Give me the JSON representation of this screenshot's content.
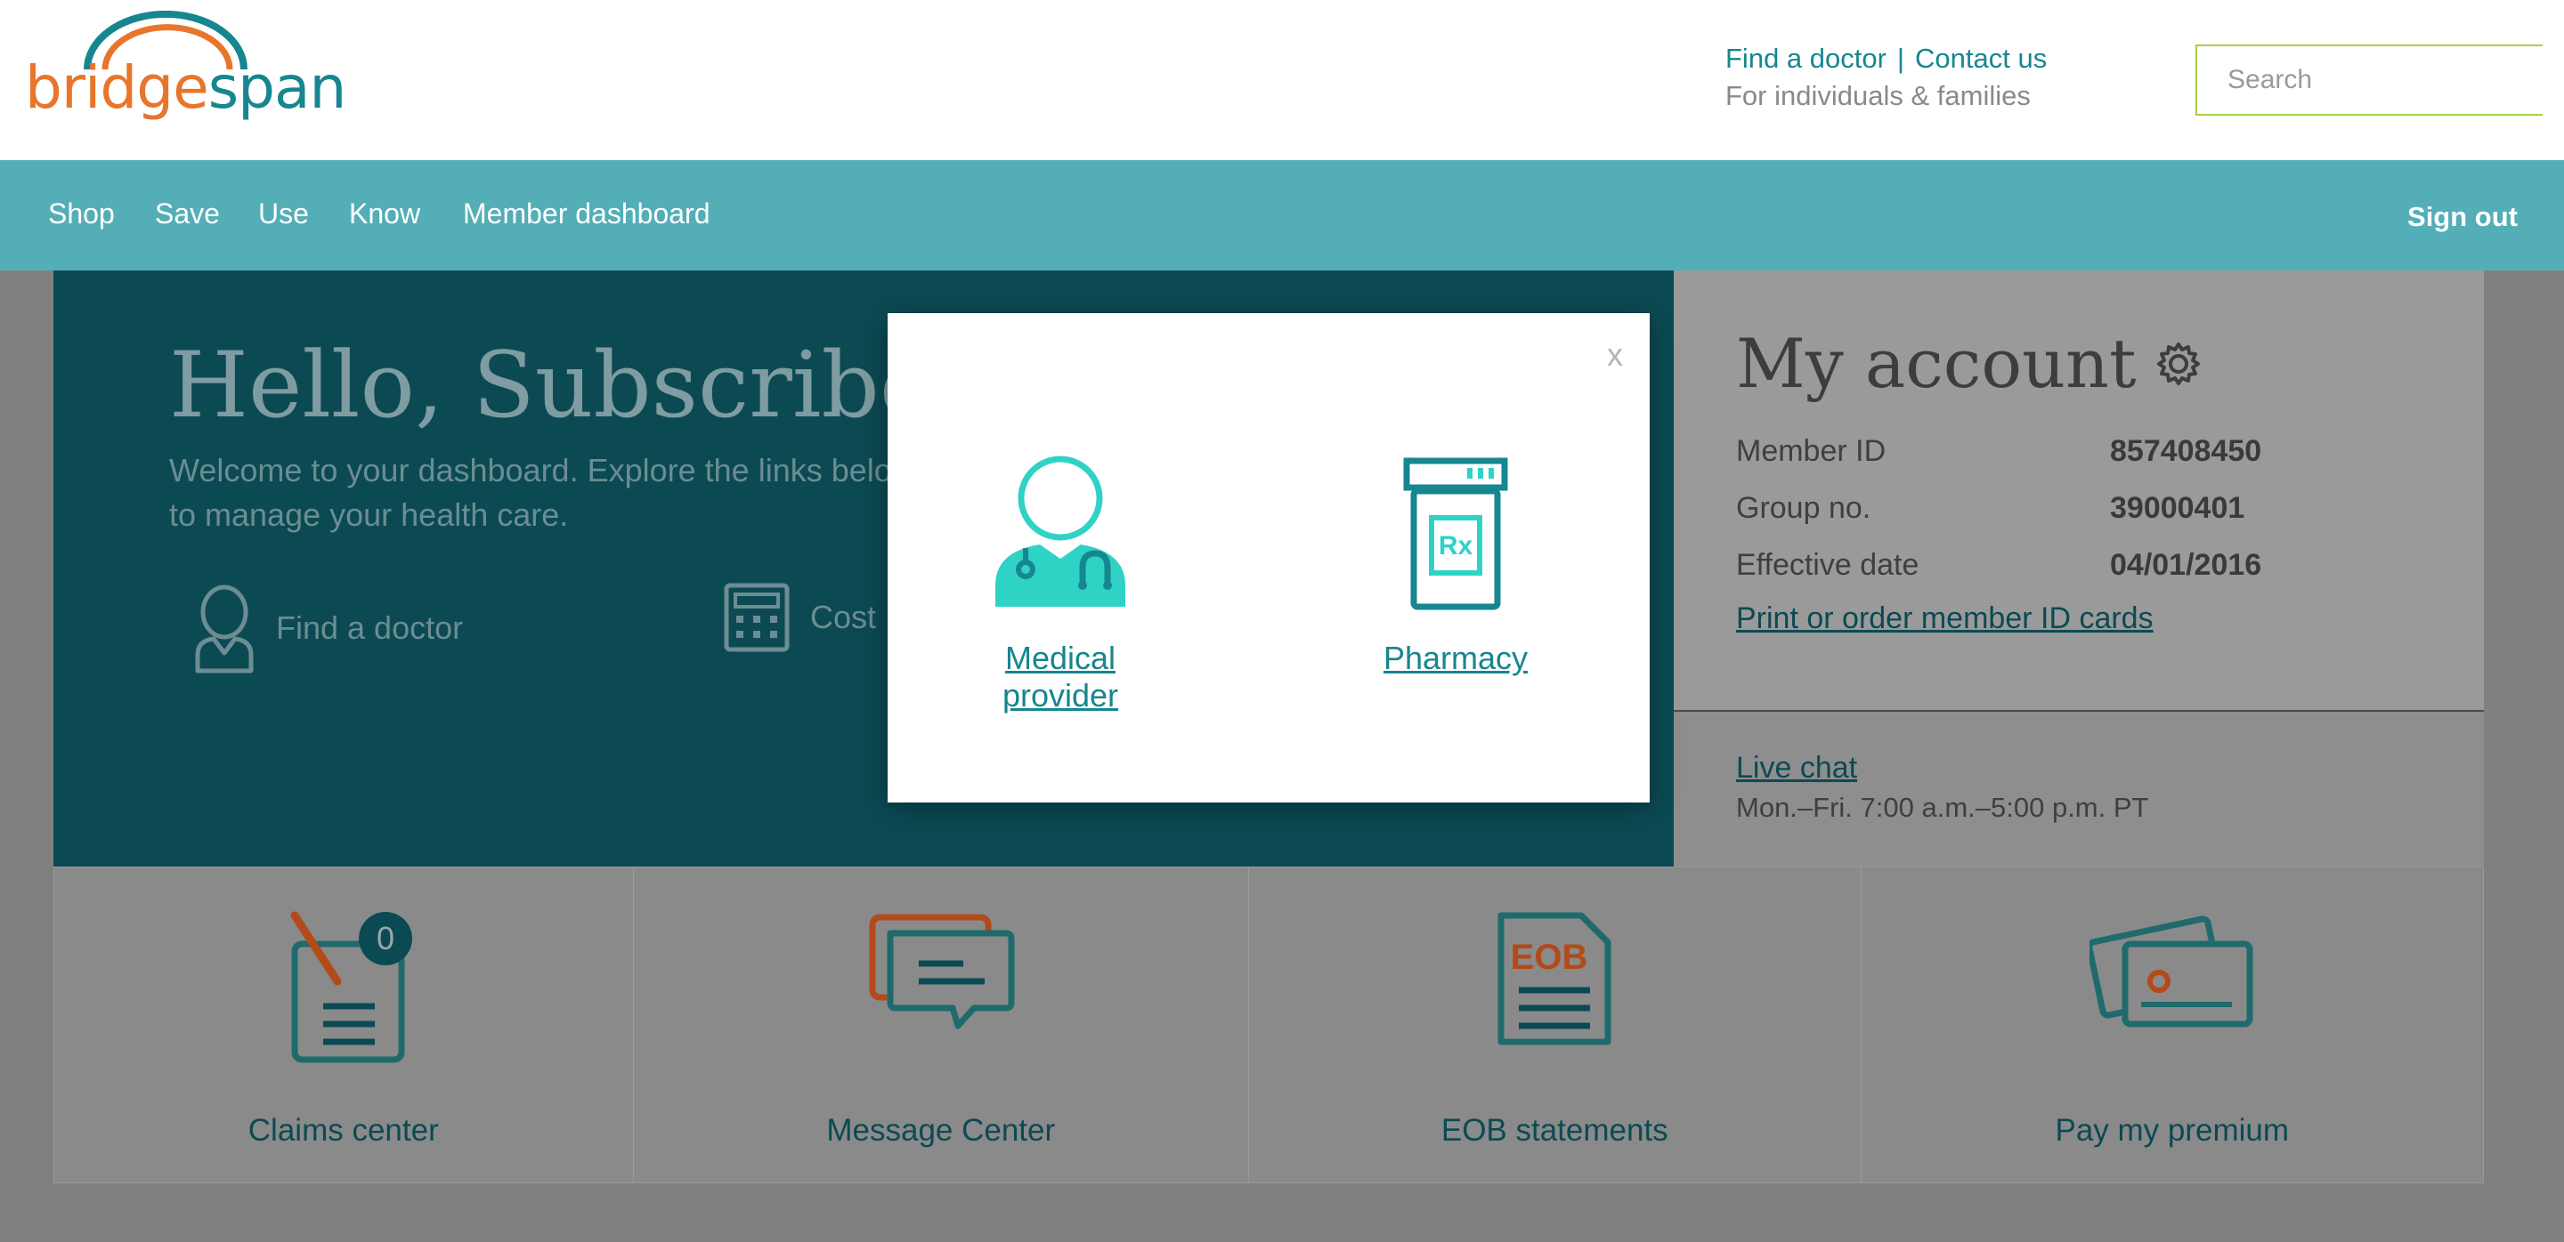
{
  "header": {
    "logo_text_a": "bridge",
    "logo_text_b": "span",
    "links": [
      "Find a doctor",
      "Contact us"
    ],
    "separator": "|",
    "subtitle": "For individuals & families",
    "search": {
      "placeholder": "Search"
    }
  },
  "nav": {
    "items": [
      "Shop",
      "Save",
      "Use",
      "Know",
      "Member dashboard"
    ],
    "sign_out": "Sign out"
  },
  "hero": {
    "greeting": "Hello, Subscriber",
    "welcome": "Welcome to your dashboard. Explore the links below to manage your health care.",
    "links": [
      "Find a doctor",
      "Cost"
    ]
  },
  "account": {
    "title": "My account",
    "rows": [
      {
        "label": "Member ID",
        "value": "857408450"
      },
      {
        "label": "Group no.",
        "value": "39000401"
      },
      {
        "label": "Effective date",
        "value": "04/01/2016"
      }
    ],
    "id_cards_link": "Print or order member ID cards",
    "chat_link": "Live chat",
    "chat_hours": "Mon.–Fri. 7:00 a.m.–5:00 p.m. PT"
  },
  "tiles": [
    {
      "label": "Claims center",
      "badge": "0"
    },
    {
      "label": "Message Center"
    },
    {
      "label": "EOB statements",
      "icon_text": "EOB"
    },
    {
      "label": "Pay my premium"
    }
  ],
  "modal": {
    "close_label": "x",
    "options": [
      {
        "label": "Medical provider",
        "icon": "doctor-icon"
      },
      {
        "label": "Pharmacy",
        "icon": "pill-bottle-icon",
        "icon_text": "Rx"
      }
    ]
  },
  "colors": {
    "teal_nav": "#54aeb7",
    "teal_dark": "#0b4a53",
    "teal_link": "#16868f",
    "orange": "#e8752b",
    "green_border": "#a8cf45",
    "modal_icon": "#2fd3c6"
  }
}
